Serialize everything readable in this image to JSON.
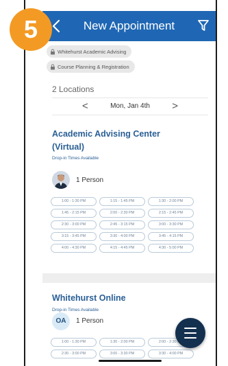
{
  "step_badge": "5",
  "header": {
    "title": "New Appointment",
    "back_icon": "chevron-left-icon",
    "filter_icon": "filter-icon"
  },
  "chips": [
    "Whitehurst Academic Advising",
    "Course Planning & Registration"
  ],
  "locations_count": "2 Locations",
  "date": {
    "label": "Mon, Jan 4th",
    "prev": "<",
    "next": ">"
  },
  "locations": [
    {
      "title": "Academic Advising Center (Virtual)",
      "subtitle": "Drop-in Times Available",
      "person": "1 Person",
      "slots": [
        "1:00 - 1:30 PM",
        "1:15 - 1:45 PM",
        "1:30 - 2:00 PM",
        "1:45 - 2:15 PM",
        "2:00 - 2:30 PM",
        "2:15 - 2:45 PM",
        "2:30 - 3:00 PM",
        "2:45 - 3:15 PM",
        "3:00 - 3:30 PM",
        "3:15 - 3:45 PM",
        "3:30 - 4:00 PM",
        "3:45 - 4:15 PM",
        "4:00 - 4:30 PM",
        "4:15 - 4:45 PM",
        "4:30 - 5:00 PM"
      ]
    },
    {
      "title": "Whitehurst Online",
      "subtitle": "Drop-in Times Available",
      "avatar_initials": "OA",
      "person": "1 Person",
      "slots": [
        "1:00 - 1:30 PM",
        "1:30 - 2:00 PM",
        "2:00 - 2:30 PM",
        "2:30 - 3:00 PM",
        "3:00 - 3:30 PM",
        "3:30 - 4:00 PM"
      ]
    }
  ],
  "colors": {
    "header": "#1f67b4",
    "accent": "#2a5f95",
    "badge": "#f39a25",
    "fab": "#14304f"
  }
}
